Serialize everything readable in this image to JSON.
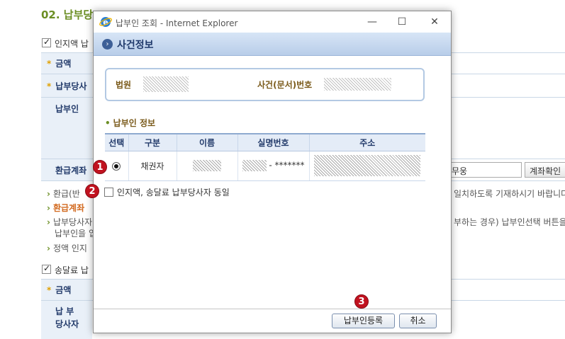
{
  "background": {
    "section_title": "02. 납부당",
    "approval_checkbox_label": "인지액 납",
    "row_amount": "금액",
    "row_payer_party": "납부당사",
    "row_payer": "납부인",
    "row_refund": "환급계좌",
    "bank_value": "무웅",
    "account_check_button": "계좌확인",
    "notes": [
      {
        "text": "환급(반",
        "style": "normal"
      },
      {
        "text": "환급계좌",
        "style": "orange"
      },
      {
        "text": "납부당사자",
        "style": "normal"
      },
      {
        "text": "납부인을 입",
        "style": "indent"
      },
      {
        "text": "정액 인지",
        "style": "normal"
      }
    ],
    "note_right_1": "일치하도록 기재하시기 바랍니다",
    "note_right_2": "부하는 경우) 납부인선택 버튼을",
    "delivery_checkbox_label": "송달료 납",
    "row_amount_2": "금액",
    "row_payer_2a": "납 부",
    "row_payer_2b": "당사자"
  },
  "popup": {
    "window_title": "납부인 조회 - Internet Explorer",
    "controls": {
      "minimize": "—",
      "maximize": "☐",
      "close": "✕"
    },
    "header_title": "사건정보",
    "case_info": {
      "court_label": "법원",
      "case_number_label": "사건(문서)번호"
    },
    "payer_section_title": "납부인 정보",
    "table": {
      "columns": [
        "선택",
        "구분",
        "이름",
        "실명번호",
        "주소"
      ],
      "rows": [
        {
          "selected": true,
          "category": "채권자",
          "id_suffix": "- *******"
        }
      ]
    },
    "same_checkbox_label": "인지액, 송달료 납부당사자 동일",
    "buttons": {
      "register": "납부인등록",
      "cancel": "취소"
    }
  },
  "badges": [
    "1",
    "2",
    "3"
  ],
  "colors": {
    "accent": "#6b8e23",
    "header_navy": "#203a6c",
    "badge_red": "#c1121f"
  }
}
